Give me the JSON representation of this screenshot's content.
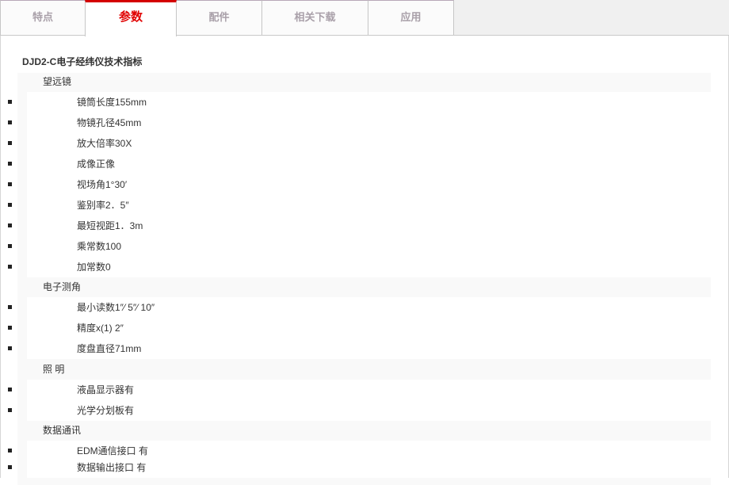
{
  "tabs": [
    {
      "label": "特点",
      "active": false
    },
    {
      "label": "参数",
      "active": true
    },
    {
      "label": "配件",
      "active": false
    },
    {
      "label": "相关下载",
      "active": false
    },
    {
      "label": "应用",
      "active": false
    }
  ],
  "title": "DJD2-C电子经纬仪技术指标",
  "sections": [
    {
      "heading": "望远镜",
      "items": [
        "镜筒长度155mm",
        "物镜孔径45mm",
        "放大倍率30X",
        "成像正像",
        "视场角1°30′",
        "鉴别率2．5″",
        "最短视距1．3m",
        "乘常数100",
        "加常数0"
      ]
    },
    {
      "heading": "电子测角",
      "items": [
        "最小读数1″⁄ 5″⁄ 10″",
        "精度x(1) 2″",
        "度盘直径71mm"
      ]
    },
    {
      "heading": "照 明",
      "items": [
        "液晶显示器有",
        "光学分划板有"
      ]
    },
    {
      "heading": "数据通讯",
      "items": [
        "EDM通信接口 有",
        "数据输出接口  有"
      ]
    }
  ],
  "colors": {
    "accent": "#d40000",
    "tab_text": "#a9a0a9"
  }
}
